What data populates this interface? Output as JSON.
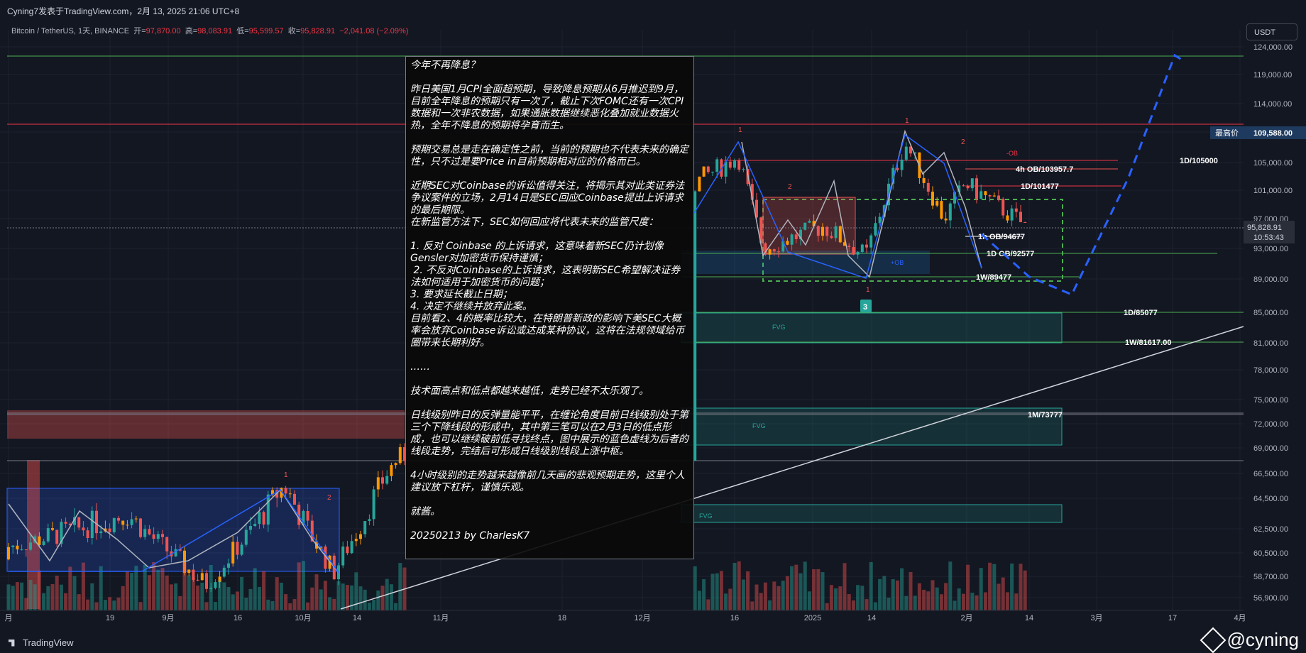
{
  "header": {
    "publisher_line": "Cyning7发表于TradingView.com，2月 13, 2025 21:06 UTC+8",
    "symbol": "Bitcoin / TetherUS, 1天, BINANCE",
    "open_label": "开=",
    "open_value": "97,870.00",
    "high_label": "高=",
    "high_value": "98,083.91",
    "low_label": "低=",
    "low_value": "95,599.57",
    "close_label": "收=",
    "close_value": "95,828.91",
    "change": "−2,041.08 (−2.09%)",
    "currency": "USDT"
  },
  "colors": {
    "background": "#131722",
    "up": "#26a69a",
    "down": "#ef5350",
    "orange": "#ff9800",
    "level_green": "#4caf50",
    "level_red": "#f23645",
    "blue_line": "#2962ff"
  },
  "chart_data": {
    "type": "line",
    "title": "Bitcoin / TetherUS, 1天, BINANCE",
    "xlabel": "",
    "ylabel": "",
    "x_ticks": [
      "月",
      "19",
      "9月",
      "16",
      "10月",
      "14",
      "11月",
      "18",
      "12月",
      "16",
      "2025",
      "14",
      "2月",
      "14",
      "3月",
      "17",
      "4月"
    ],
    "y_ticks": [
      "124,000.00",
      "119,000.00",
      "114,000.00",
      "109,588.00",
      "105,000.00",
      "101,000.00",
      "97,000.00",
      "93,000.00",
      "89,000.00",
      "85,000.00",
      "81,000.00",
      "78,000.00",
      "75,000.00",
      "72,000.00",
      "69,000.00",
      "66,500.00",
      "64,500.00",
      "62,500.00",
      "60,500.00",
      "58,700.00",
      "56,900.00"
    ],
    "ylim": [
      56000,
      125500
    ],
    "last_price": "95,828.91",
    "countdown": "10:53:43",
    "high_label": "最高价",
    "high_value": "109,588.00",
    "levels": [
      {
        "label": "1D/105000",
        "value": 105000
      },
      {
        "label": "4h OB/103957.7",
        "value": 103957.7
      },
      {
        "label": "1D/101477",
        "value": 101477
      },
      {
        "label": "1h OB/94677",
        "value": 94677
      },
      {
        "label": "1D OB/92577",
        "value": 92577
      },
      {
        "label": "1W/89477",
        "value": 89477
      },
      {
        "label": "1D/85077",
        "value": 85077
      },
      {
        "label": "1W/81617.00",
        "value": 81617
      },
      {
        "label": "1M/73777",
        "value": 73777
      }
    ],
    "zone_labels": [
      "FVG",
      "FVG",
      "FVG",
      "+OB",
      "-OB"
    ],
    "wave_labels": [
      "1",
      "2",
      "1",
      "2",
      "1",
      "2",
      "1",
      "3"
    ],
    "grid": true
  },
  "annotation": {
    "paragraphs": [
      "今年不再降息？",
      "昨日美国1月CPI全面超预期，导致降息预期从6月推迟到9月，目前全年降息的预期只有一次了，截止下次FOMC还有一次CPI数据和一次非农数据，如果通胀数据继续恶化叠加就业数据火热，全年不降息的预期将孕育而生。",
      "预期交易总是走在确定性之前，当前的预期也不代表未来的确定性，只不过是要Price in目前预期相对应的价格而已。",
      "近期SEC对Coinbase的诉讼值得关注，将揭示其对此类证券法争议案件的立场，2月14日是SEC回应Coinbase提出上诉请求的最后期限。\n在新监管方法下，SEC如何回应将代表未来的监管尺度：",
      "1. 反对 Coinbase 的上诉请求，这意味着新SEC仍计划像Gensler对加密货币保持谨慎；\n 2. 不反对Coinbase的上诉请求，这表明新SEC希望解决证券法如何适用于加密货币的问题；\n3. 要求延长截止日期；\n4. 决定不继续并放弃此案。\n目前看2、4的概率比较大，在特朗普新政的影响下美SEC大概率会放弃Coinbase诉讼或达成某种协议，这将在法规领域给币圈带来长期利好。",
      "……",
      "技术面高点和低点都越来越低，走势已经不太乐观了。",
      "日线级别昨日的反弹量能平平，在缠论角度目前日线级别处于第三个下降线段的形成中，其中第三笔可以在2月3日的低点形成，也可以继续破前低寻找终点，图中展示的蓝色虚线为后者的线段走势，完结后可形成日线级别线段上涨中枢。",
      "4小时级别的走势越来越像前几天画的悲观预期走势，这里个人建议放下杠杆，谨慎乐观。",
      "就酱。",
      "20250213 by CharlesK7"
    ]
  },
  "footer": {
    "brand": "TradingView",
    "watermark": "@cyning"
  }
}
